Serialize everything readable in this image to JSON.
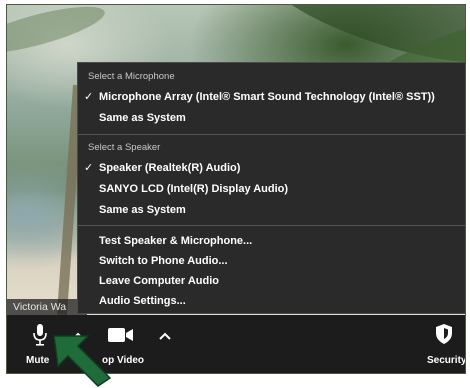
{
  "participant": {
    "name": "Victoria Wa"
  },
  "audio_menu": {
    "microphone_header": "Select a Microphone",
    "microphones": [
      {
        "label": "Microphone Array (Intel® Smart Sound Technology (Intel® SST))",
        "selected": true
      },
      {
        "label": "Same as System",
        "selected": false
      }
    ],
    "speaker_header": "Select a Speaker",
    "speakers": [
      {
        "label": "Speaker (Realtek(R) Audio)",
        "selected": true
      },
      {
        "label": "SANYO LCD (Intel(R) Display Audio)",
        "selected": false
      },
      {
        "label": "Same as System",
        "selected": false
      }
    ],
    "actions": [
      "Test Speaker & Microphone...",
      "Switch to Phone Audio...",
      "Leave Computer Audio",
      "Audio Settings..."
    ],
    "check_glyph": "✓"
  },
  "toolbar": {
    "mute_label": "Mute",
    "video_label": "op Video",
    "security_label": "Security"
  },
  "icons": {
    "microphone": "microphone-icon",
    "camera": "video-camera-icon",
    "shield": "shield-icon",
    "chevron": "chevron-up-icon"
  },
  "colors": {
    "menu_bg": "#2a2a2a",
    "toolbar_bg": "#1c1c1c",
    "arrow": "#1f6b3a"
  }
}
